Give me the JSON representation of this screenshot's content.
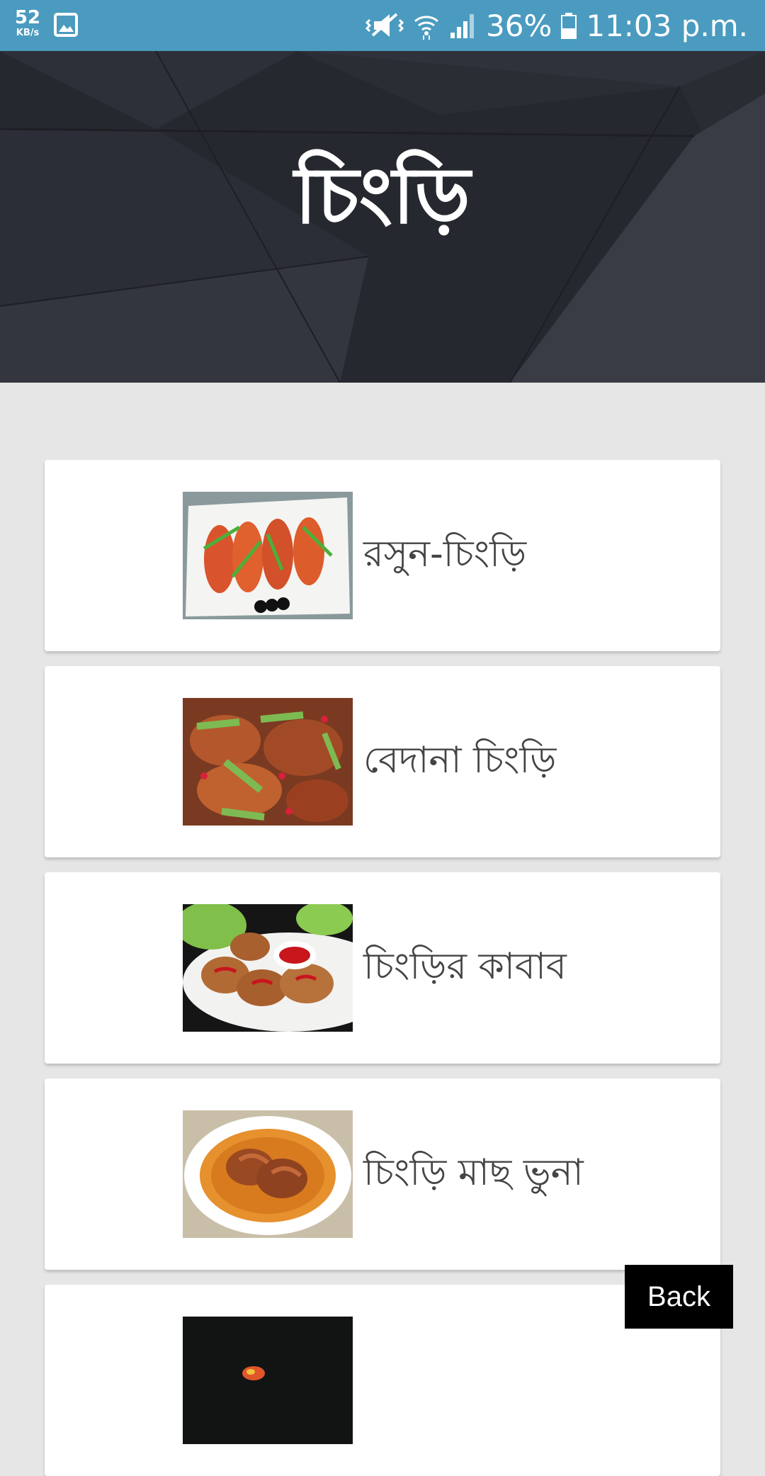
{
  "status_bar": {
    "speed_value": "52",
    "speed_unit": "KB/s",
    "battery": "36%",
    "time": "11:03 p.m.",
    "icons": [
      "image-icon",
      "vibrate-mute-icon",
      "wifi-icon",
      "signal-icon",
      "battery-icon"
    ]
  },
  "header": {
    "title": "চিংড়ি"
  },
  "recipes": [
    {
      "label": "রসুন-চিংড়ি",
      "image": "garlic-prawn-photo"
    },
    {
      "label": "বেদানা চিংড়ি",
      "image": "pomegranate-prawn-photo"
    },
    {
      "label": "চিংড়ির কাবাব",
      "image": "prawn-kebab-photo"
    },
    {
      "label": "চিংড়ি মাছ ভুনা",
      "image": "prawn-bhuna-photo"
    },
    {
      "label": "",
      "image": "partial-recipe-photo"
    }
  ],
  "back_button": {
    "label": "Back"
  },
  "colors": {
    "status_bar": "#4a9bbf",
    "header_bg": "#262830",
    "page_bg": "#e6e6e6",
    "card_bg": "#ffffff",
    "back_button_bg": "#000000"
  }
}
